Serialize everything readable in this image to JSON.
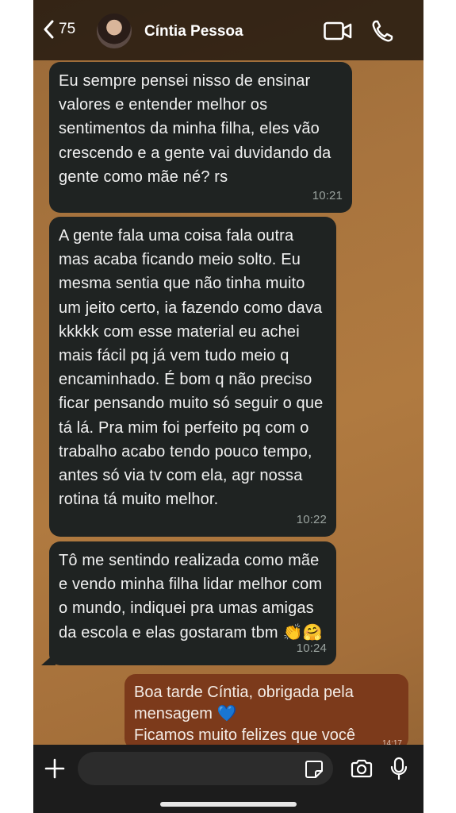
{
  "header": {
    "back_count": "75",
    "contact_name": "Cíntia Pessoa"
  },
  "messages": [
    {
      "direction": "in",
      "text": "Eu sempre pensei nisso de ensinar valores e entender melhor os sentimentos da minha filha, eles vão crescendo e a gente vai duvidando da gente como mãe né? rs",
      "time": "10:21"
    },
    {
      "direction": "in",
      "text": "A gente fala uma coisa fala outra mas acaba ficando meio solto. Eu mesma sentia que não tinha muito um jeito certo, ia fazendo como dava kkkkk com esse material eu achei mais fácil pq já vem tudo meio q encaminhado. É bom q não preciso ficar pensando muito só seguir o que tá lá. Pra mim foi perfeito pq com o trabalho acabo tendo pouco tempo, antes só via tv com ela, agr nossa rotina tá muito melhor.",
      "time": "10:22"
    },
    {
      "direction": "in",
      "text": "Tô me sentindo realizada como mãe e vendo minha filha lidar melhor com o mundo, indiquei pra umas amigas da escola e elas gostaram tbm",
      "emojis": "👏🤗",
      "time": "10:24"
    },
    {
      "direction": "out",
      "line1": "Boa tarde Cíntia, obrigada pela",
      "line2": "mensagem",
      "heart": "💙",
      "line3": "Ficamos muito felizes que você",
      "time": "14:17"
    }
  ],
  "composer": {
    "placeholder": ""
  },
  "colors": {
    "incoming_bubble": "#1f2322",
    "outgoing_bubble": "#7c3a1b",
    "header_bg": "#0c0a08"
  },
  "icons": [
    "chevron-left-icon",
    "video-camera-icon",
    "phone-icon",
    "plus-icon",
    "sticker-icon",
    "camera-icon",
    "microphone-icon"
  ]
}
